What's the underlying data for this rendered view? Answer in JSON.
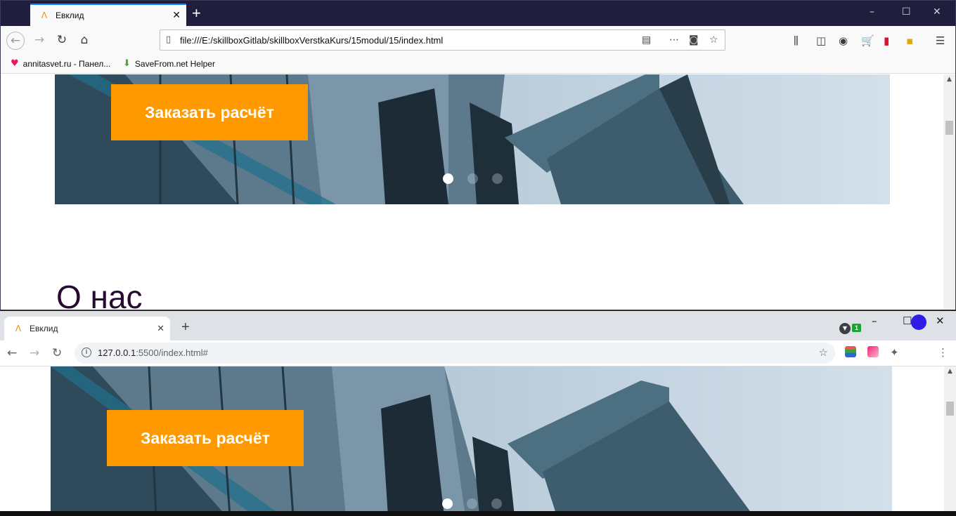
{
  "firefox": {
    "tab_title": "Евклид",
    "favicon": "Λ",
    "url": "file:///E:/skillboxGitlab/skillboxVerstkaKurs/15modul/15/index.html",
    "bookmarks": [
      {
        "label": "annitasvet.ru - Панел...",
        "icon": "pink-heart-icon"
      },
      {
        "label": "SaveFrom.net Helper",
        "icon": "green-download-icon"
      }
    ],
    "window_controls": {
      "minimize": "–",
      "maximize": "☐",
      "close": "✕"
    },
    "page": {
      "order_button": "Заказать расчёт",
      "about_heading": "О нас",
      "slider": {
        "count": 3,
        "active_index": 0
      }
    }
  },
  "chrome": {
    "tab_title": "Евклид",
    "favicon": "Λ",
    "url_host": "127.0.0.1",
    "url_rest": ":5500/index.html#",
    "extension_badge": "1",
    "window_controls": {
      "minimize": "–",
      "maximize": "☐",
      "close": "✕"
    },
    "page": {
      "order_button": "Заказать расчёт",
      "slider": {
        "count": 3,
        "active_index": 0
      }
    }
  },
  "colors": {
    "accent_orange": "#ff9900",
    "heading_color": "#260a2f",
    "firefox_titlebar": "#1f1f3d",
    "chrome_tabstrip": "#dee1e6"
  }
}
